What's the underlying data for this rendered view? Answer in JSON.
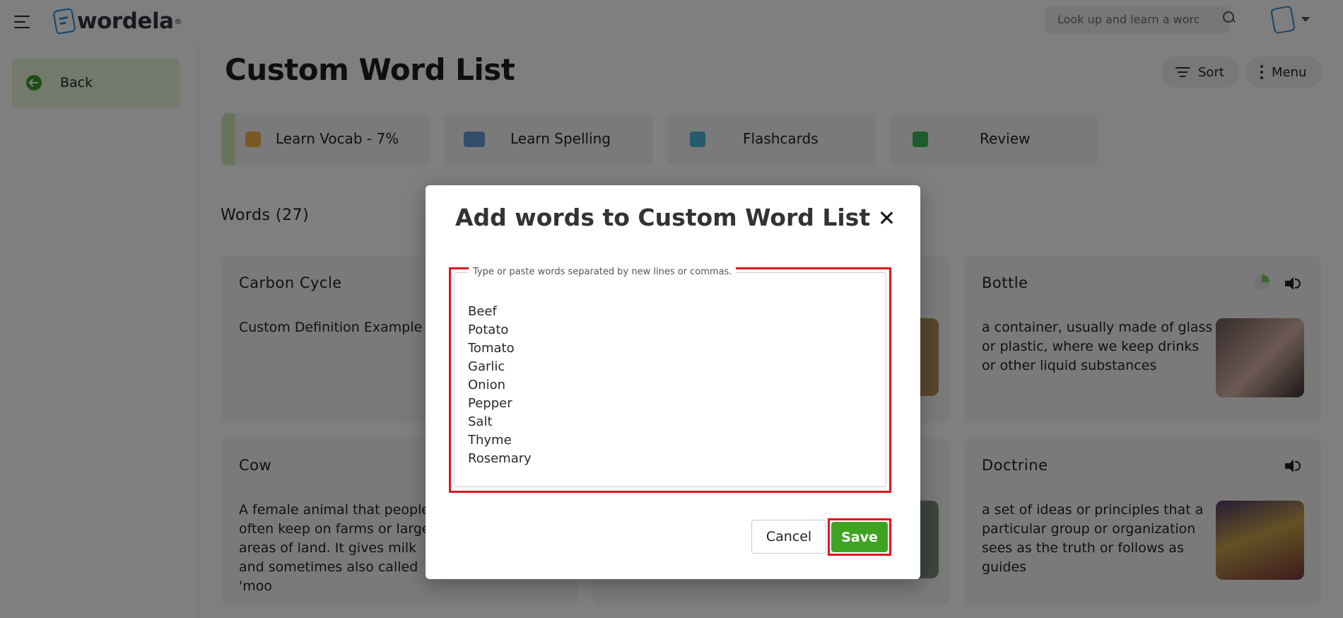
{
  "app": {
    "logo_text": "wordela",
    "logo_reg": "®",
    "search_placeholder": "Look up and learn a word"
  },
  "sidebar": {
    "back_label": "Back"
  },
  "page": {
    "title": "Custom Word List",
    "sort_label": "Sort",
    "menu_label": "Menu",
    "words_count": "Words (27)"
  },
  "tabs": [
    {
      "label": "Learn Vocab - 7%",
      "icon": "vocab-icon",
      "color": "#f0a13a"
    },
    {
      "label": "Learn Spelling",
      "icon": "spelling-icon",
      "color": "#3a78c9"
    },
    {
      "label": "Flashcards",
      "icon": "flashcards-icon",
      "color": "#3aa6c9"
    },
    {
      "label": "Review",
      "icon": "review-icon",
      "color": "#2fa84a"
    }
  ],
  "cards": [
    {
      "title": "Carbon Cycle",
      "definition": "Custom Definition Example"
    },
    {
      "title": "Bottle",
      "definition": "a container, usually made of glass or plastic, where we keep drinks or other liquid substances"
    },
    {
      "title": "Cow",
      "definition": "A female animal that people often keep on farms or large areas of land. It gives milk and sometimes also called 'moo"
    },
    {
      "title": "Doctrine",
      "definition": "a set of ideas or principles that a particular group or organization sees as the truth or follows as guides"
    }
  ],
  "modal": {
    "title": "Add words to Custom Word List",
    "field_label": "Type or paste words separated by new lines or commas.",
    "words": "Beef\nPotato\nTomato\nGarlic\nOnion\nPepper\nSalt\nThyme\nRosemary",
    "cancel_label": "Cancel",
    "save_label": "Save"
  },
  "colors": {
    "accent_green": "#3ea321",
    "highlight_red": "#e3141f",
    "brand_blue": "#2d8ad6"
  }
}
